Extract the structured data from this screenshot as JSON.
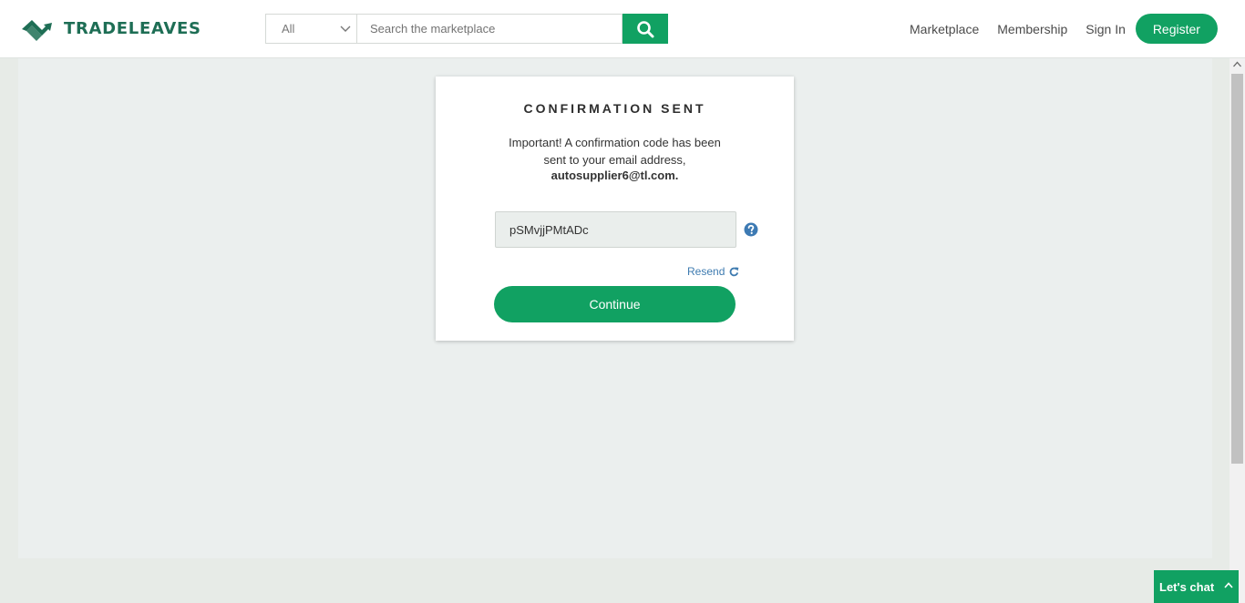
{
  "brand": {
    "name": "TRADELEAVES",
    "accent": "#11a162",
    "logo_color": "#1e6e55"
  },
  "search": {
    "category": "All",
    "placeholder": "Search the marketplace",
    "value": "",
    "button_icon": "search-icon"
  },
  "nav": {
    "links": [
      "Marketplace",
      "Membership",
      "Sign In"
    ],
    "register": "Register"
  },
  "confirmation": {
    "title": "CONFIRMATION SENT",
    "message": "Important! A confirmation code has been sent to your email address,",
    "email": "autosupplier6@tl.com.",
    "code_value": "pSMvjjPMtADc",
    "help_icon": "question-circle-icon",
    "resend": "Resend",
    "resend_icon": "refresh-icon",
    "continue": "Continue"
  },
  "chat": {
    "label": "Let's chat",
    "icon": "chevron-up-icon"
  }
}
